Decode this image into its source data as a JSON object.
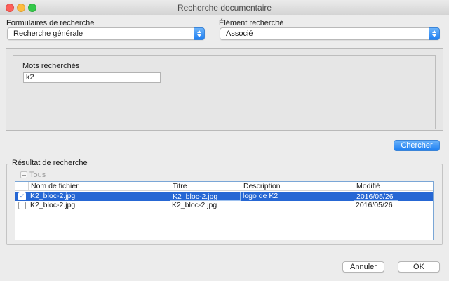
{
  "window": {
    "title": "Recherche documentaire"
  },
  "forms": {
    "label": "Formulaires de recherche",
    "selected": "Recherche générale"
  },
  "element": {
    "label": "Élément recherché",
    "selected": "Associé"
  },
  "search": {
    "label": "Mots recherchés",
    "value": "k2",
    "button": "Chercher"
  },
  "results": {
    "legend": "Résultat de recherche",
    "select_all": "Tous",
    "columns": [
      "Nom de fichier",
      "Titre",
      "Description",
      "Modifié"
    ],
    "rows": [
      {
        "checked": true,
        "selected": true,
        "file": "K2_bloc-2.jpg",
        "title": "K2_bloc-2.jpg",
        "description": "logo de K2",
        "modified": "2016/05/26"
      },
      {
        "checked": false,
        "selected": false,
        "file": "K2_bloc-2.jpg",
        "title": "K2_bloc-2.jpg",
        "description": "",
        "modified": "2016/05/26"
      }
    ]
  },
  "footer": {
    "cancel": "Annuler",
    "ok": "OK"
  },
  "colors": {
    "accent": "#2667d4",
    "primary_button": "#1d7ff2"
  }
}
